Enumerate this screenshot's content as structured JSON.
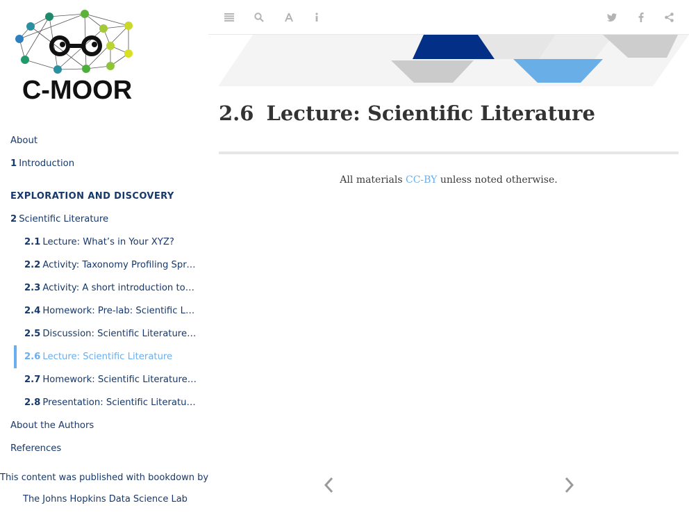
{
  "logo": {
    "text": "C-MOOR"
  },
  "sidebar": {
    "items": [
      {
        "num": "",
        "label": "About",
        "type": "top"
      },
      {
        "num": "1",
        "label": "Introduction",
        "type": "top"
      },
      {
        "num": "",
        "label": "Exploration and Discovery",
        "type": "header"
      },
      {
        "num": "2",
        "label": "Scientific Literature",
        "type": "top"
      },
      {
        "num": "2.1",
        "label": "Lecture: What’s in Your XYZ?",
        "type": "sub"
      },
      {
        "num": "2.2",
        "label": "Activity: Taxonomy Profiling Spre…",
        "type": "sub"
      },
      {
        "num": "2.3",
        "label": "Activity: A short introduction to G…",
        "type": "sub"
      },
      {
        "num": "2.4",
        "label": "Homework: Pre-lab: Scientific Lite…",
        "type": "sub"
      },
      {
        "num": "2.5",
        "label": "Discussion: Scientific Literature P…",
        "type": "sub"
      },
      {
        "num": "2.6",
        "label": "Lecture: Scientific Literature",
        "type": "sub",
        "active": true
      },
      {
        "num": "2.7",
        "label": "Homework: Scientific Literature A…",
        "type": "sub"
      },
      {
        "num": "2.8",
        "label": "Presentation: Scientific Literature…",
        "type": "sub"
      },
      {
        "num": "",
        "label": "About the Authors",
        "type": "top"
      },
      {
        "num": "",
        "label": "References",
        "type": "top"
      }
    ],
    "published_label": "This content was published with bookdown by:",
    "publisher_link": "The Johns Hopkins Data Science Lab"
  },
  "toolbar": {
    "left_icons": [
      "menu-icon",
      "search-icon",
      "font-icon",
      "info-icon"
    ],
    "right_icons": [
      "twitter-icon",
      "facebook-icon",
      "share-icon"
    ]
  },
  "main": {
    "section_number": "2.6",
    "title": "Lecture: Scientific Literature",
    "license_prefix": "All materials ",
    "license_link": "CC-BY",
    "license_suffix": " unless noted otherwise."
  },
  "colors": {
    "accent": "#68aef0",
    "nav_text": "#17386a",
    "banner_dark": "#032f86",
    "banner_light_blue": "#6aaee8",
    "banner_gray": "#c8c8c8"
  }
}
